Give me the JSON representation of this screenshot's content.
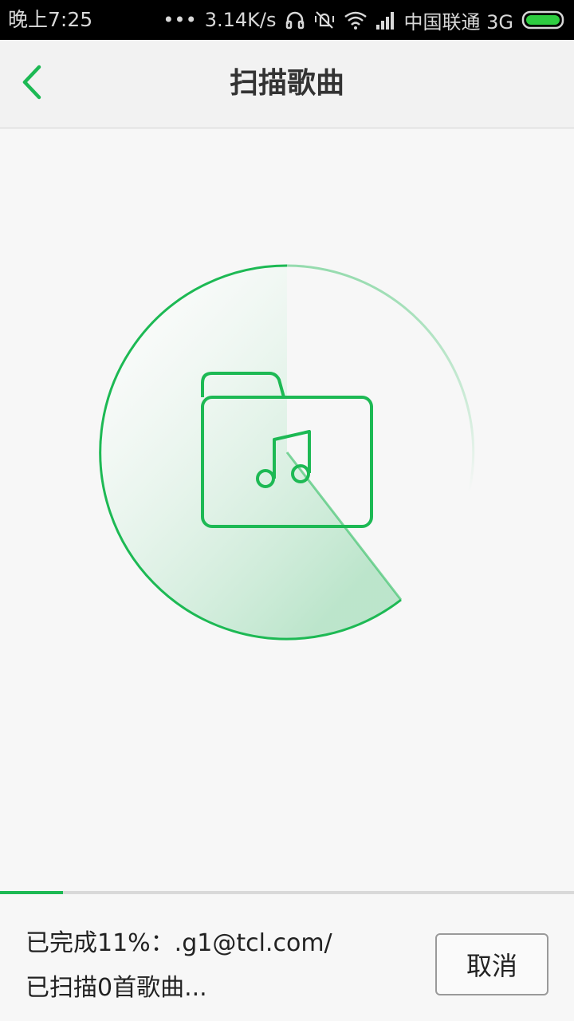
{
  "status_bar": {
    "time": "晚上7:25",
    "dots": "•••",
    "net_speed": "3.14K/s",
    "carrier": "中国联通 3G",
    "icons": [
      "headphones-icon",
      "mute-vibrate-icon",
      "wifi-icon",
      "signal-icon",
      "battery-icon"
    ]
  },
  "header": {
    "title": "扫描歌曲",
    "back_icon": "chevron-left-icon"
  },
  "scan": {
    "progress_percent": 11,
    "status_line1": "已完成11%：.g1@tcl.com/",
    "status_line2": "已扫描0首歌曲...",
    "cancel_label": "取消"
  },
  "colors": {
    "accent": "#1db954",
    "title_text": "#333333",
    "background": "#f7f7f7"
  }
}
